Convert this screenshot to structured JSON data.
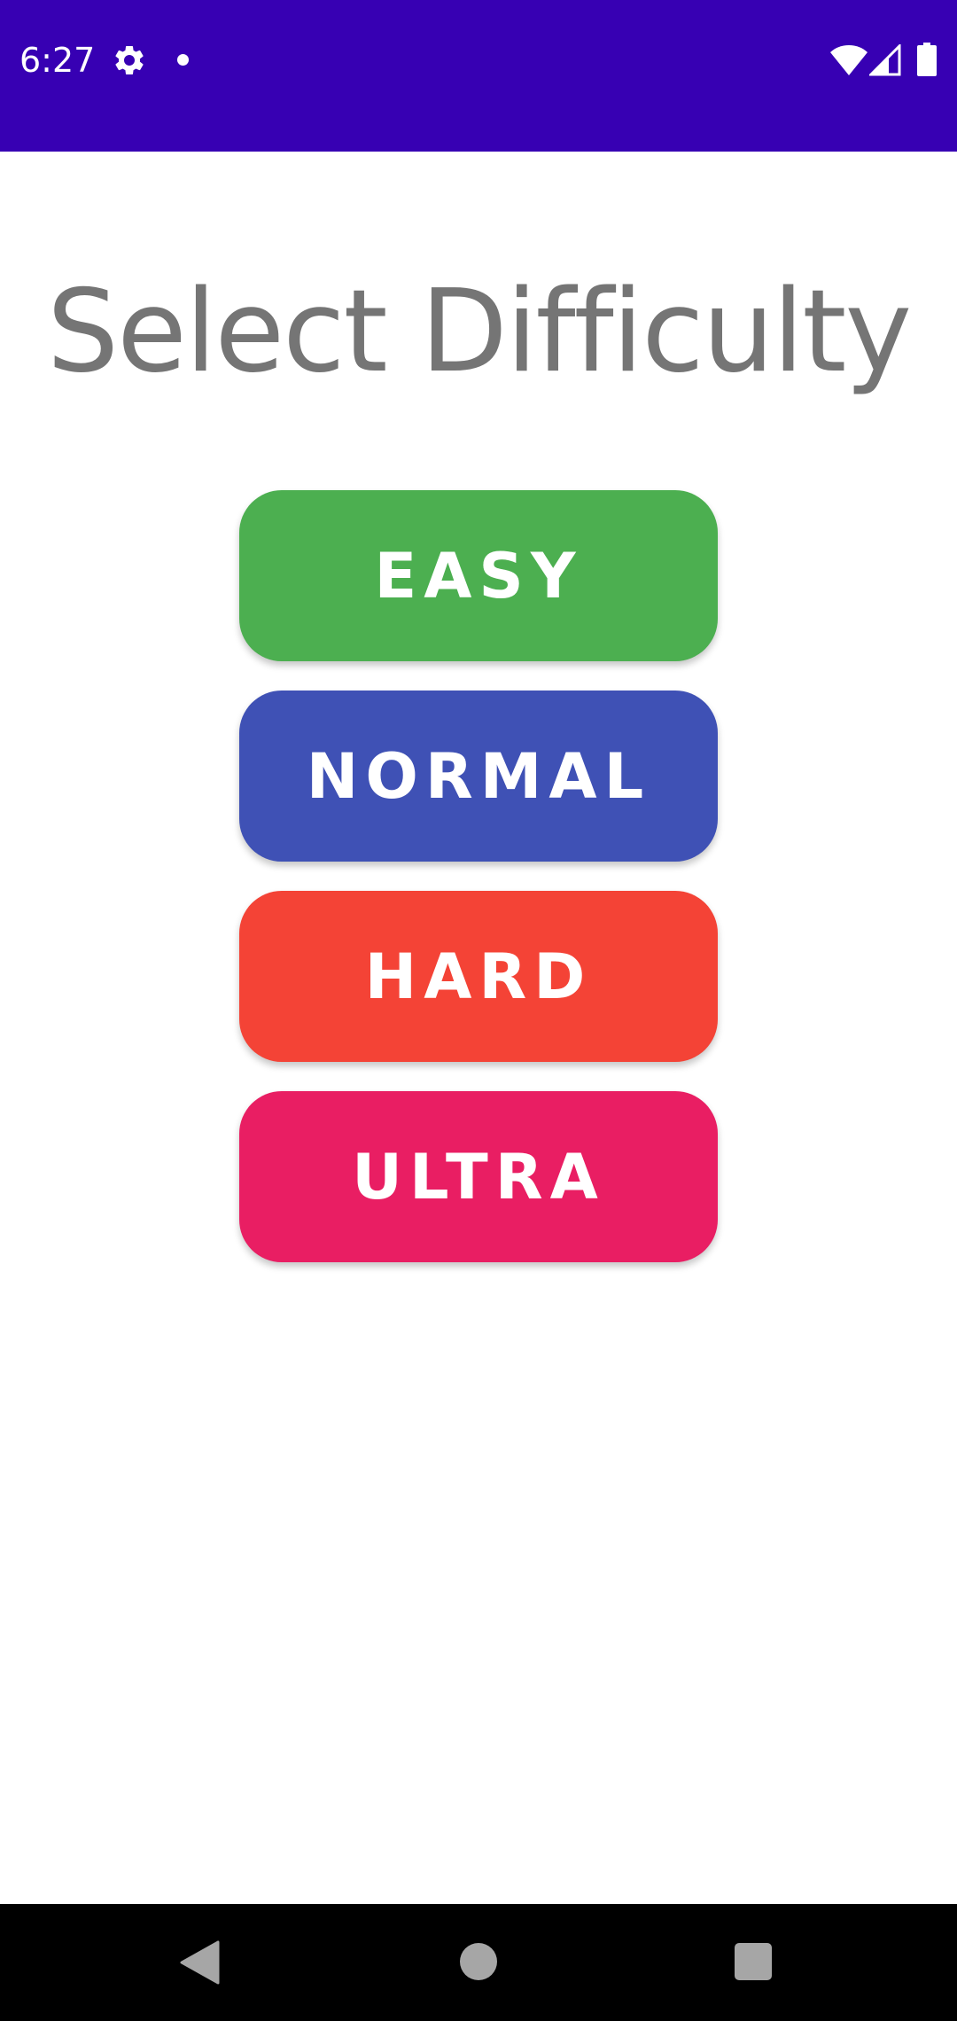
{
  "status_bar": {
    "time": "6:27",
    "background_color": "#3700b3",
    "icons": [
      "gear-icon",
      "notification-dot-icon",
      "wifi-icon",
      "signal-icon",
      "battery-icon"
    ]
  },
  "main": {
    "title": "Select Difficulty",
    "title_color": "#757575",
    "buttons": [
      {
        "label": "EASY",
        "color": "#4caf50"
      },
      {
        "label": "NORMAL",
        "color": "#3f51b5"
      },
      {
        "label": "HARD",
        "color": "#f44336"
      },
      {
        "label": "ULTRA",
        "color": "#e91e63"
      }
    ]
  },
  "nav_bar": {
    "icons": [
      "back-icon",
      "home-icon",
      "recents-icon"
    ]
  }
}
